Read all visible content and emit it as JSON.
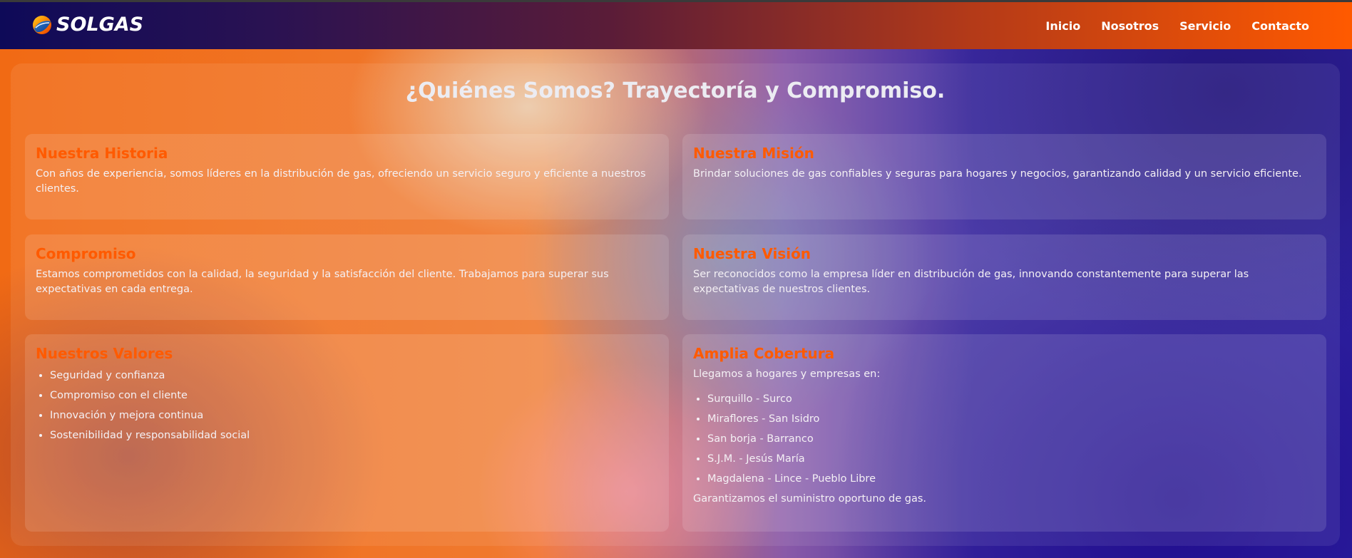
{
  "header": {
    "brand": "SOLGAS",
    "nav": [
      "Inicio",
      "Nosotros",
      "Servicio",
      "Contacto"
    ]
  },
  "main": {
    "title": "¿Quiénes Somos? Trayectoría y Compromiso.",
    "cards": {
      "historia": {
        "title": "Nuestra Historia",
        "text": "Con años de experiencia, somos líderes en la distribución de gas, ofreciendo un servicio seguro y eficiente a nuestros clientes."
      },
      "mision": {
        "title": "Nuestra Misión",
        "text": "Brindar soluciones de gas confiables y seguras para hogares y negocios, garantizando calidad y un servicio eficiente."
      },
      "compromiso": {
        "title": "Compromiso",
        "text": "Estamos comprometidos con la calidad, la seguridad y la satisfacción del cliente. Trabajamos para superar sus expectativas en cada entrega."
      },
      "vision": {
        "title": "Nuestra Visión",
        "text": "Ser reconocidos como la empresa líder en distribución de gas, innovando constantemente para superar las expectativas de nuestros clientes."
      },
      "valores": {
        "title": "Nuestros Valores",
        "items": [
          "Seguridad y confianza",
          "Compromiso con el cliente",
          "Innovación y mejora continua",
          "Sostenibilidad y responsabilidad social"
        ]
      },
      "cobertura": {
        "title": "Amplia Cobertura",
        "intro": "Llegamos a hogares y empresas en:",
        "items": [
          "Surquillo - Surco",
          "Miraflores - San Isidro",
          "San borja - Barranco",
          "S.J.M. - Jesús María",
          "Magdalena - Lince - Pueblo Libre"
        ],
        "footer": "Garantizamos el suministro oportuno de gas."
      }
    }
  },
  "colors": {
    "accent": "#ff5a00",
    "navy": "#0e0a58"
  },
  "icons": {
    "logo": "flame-sphere-icon"
  }
}
